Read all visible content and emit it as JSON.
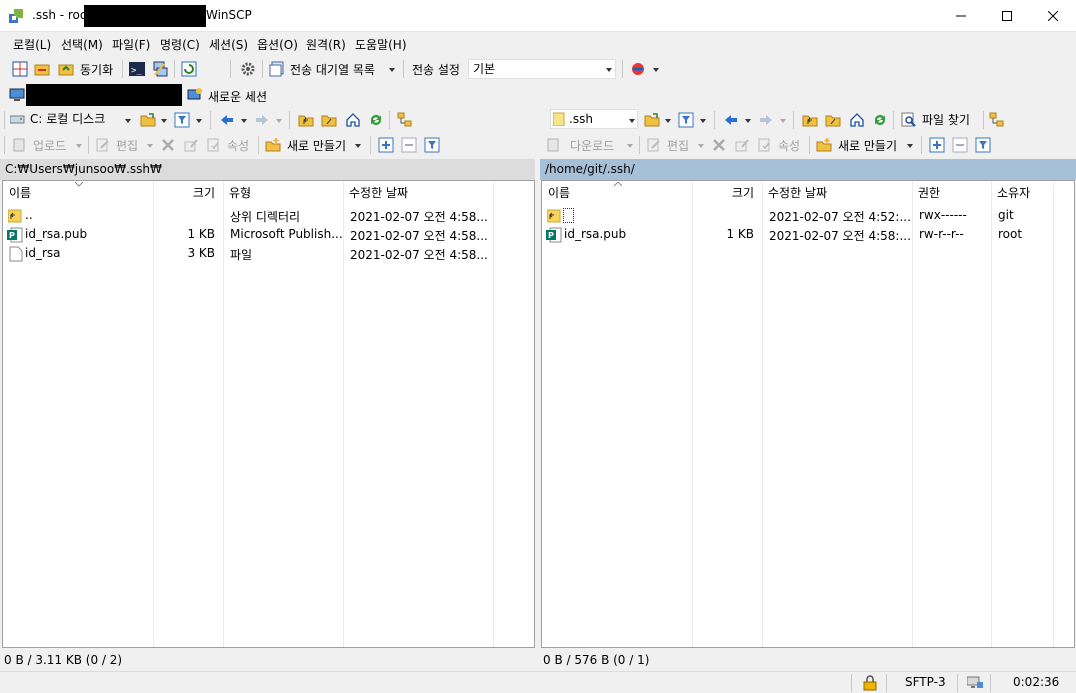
{
  "window": {
    "title_prefix": ".ssh - roo",
    "title_suffix": "WinSCP",
    "minimize_glyph": "—",
    "maximize_glyph": "☐",
    "close_glyph": "✕"
  },
  "menu": {
    "items": [
      "로컬(L)",
      "선택(M)",
      "파일(F)",
      "명령(C)",
      "세션(S)",
      "옵션(O)",
      "원격(R)",
      "도움말(H)"
    ]
  },
  "main_toolbar": {
    "sync_label": "동기화",
    "queue_label": "전송 대기열 목록",
    "transfer_settings_label": "전송 설정",
    "transfer_settings_value": "기본"
  },
  "session_tabs": {
    "new_session_label": "새로운 세션"
  },
  "local": {
    "drive_label": "C: 로컬 디스크",
    "upload_label": "업로드",
    "edit_label": "편집",
    "properties_label": "속성",
    "new_label": "새로 만들기",
    "path": "C:₩Users₩junsoo₩.ssh₩",
    "columns": {
      "name": "이름",
      "size": "크기",
      "type": "유형",
      "modified": "수정한 날짜"
    },
    "rows": [
      {
        "icon": "parent-folder-icon",
        "name": "..",
        "size": "",
        "type": "상위 디렉터리",
        "modified": "2021-02-07  오전 4:58..."
      },
      {
        "icon": "publisher-file-icon",
        "name": "id_rsa.pub",
        "size": "1 KB",
        "type": "Microsoft Publish...",
        "modified": "2021-02-07  오전 4:58..."
      },
      {
        "icon": "file-icon",
        "name": "id_rsa",
        "size": "3 KB",
        "type": "파일",
        "modified": "2021-02-07  오전 4:58..."
      }
    ],
    "status": "0 B / 3.11 KB (0 / 2)"
  },
  "remote": {
    "dir_label": ".ssh",
    "download_label": "다운로드",
    "edit_label": "편집",
    "properties_label": "속성",
    "new_label": "새로 만들기",
    "find_label": "파일 찾기",
    "path": "/home/git/.ssh/",
    "columns": {
      "name": "이름",
      "size": "크기",
      "modified": "수정한 날짜",
      "rights": "권한",
      "owner": "소유자"
    },
    "rows": [
      {
        "icon": "parent-folder-icon",
        "name": "",
        "size": "",
        "modified": "2021-02-07  오전 4:52:...",
        "rights": "rwx------",
        "owner": "git"
      },
      {
        "icon": "publisher-file-icon",
        "name": "id_rsa.pub",
        "size": "1 KB",
        "modified": "2021-02-07  오전 4:58:...",
        "rights": "rw-r--r--",
        "owner": "root"
      }
    ],
    "status": "0 B / 576 B (0 / 1)"
  },
  "bottom_status": {
    "protocol": "SFTP-3",
    "time": "0:02:36"
  },
  "colors": {
    "local_path_bg": "#dcdcdc",
    "remote_path_bg": "#a6c0d8",
    "accent": "#3a74c4"
  }
}
